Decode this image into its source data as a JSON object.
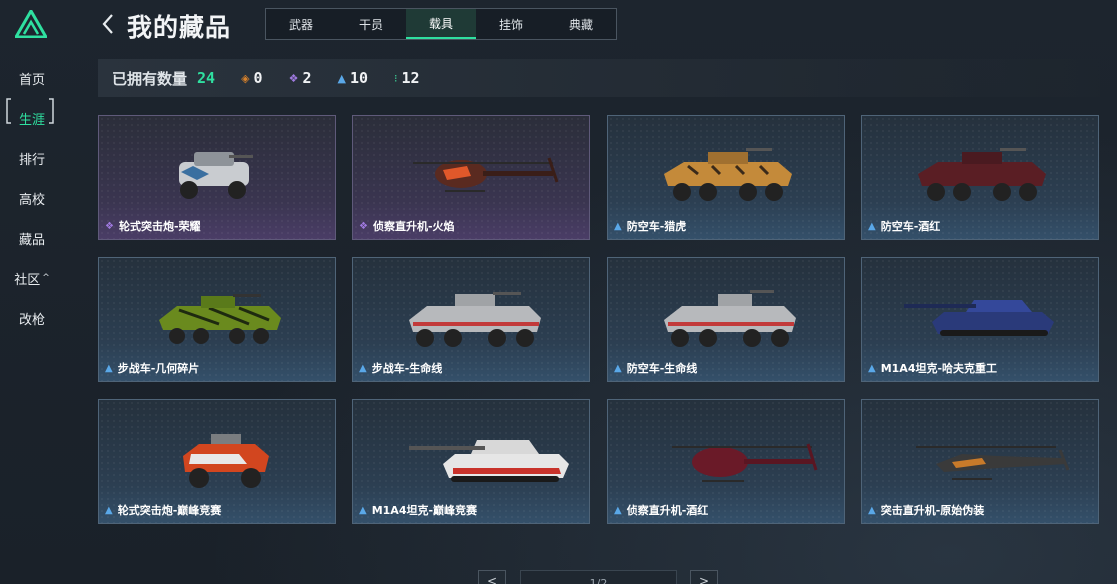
{
  "nav": {
    "items": [
      {
        "label": "首页"
      },
      {
        "label": "生涯"
      },
      {
        "label": "排行"
      },
      {
        "label": "高校"
      },
      {
        "label": "藏品"
      },
      {
        "label": "社区",
        "chevron": "^"
      },
      {
        "label": "改枪"
      }
    ]
  },
  "header": {
    "title": "我的藏品",
    "tabs": [
      {
        "label": "武器"
      },
      {
        "label": "干员"
      },
      {
        "label": "载具"
      },
      {
        "label": "挂饰"
      },
      {
        "label": "典藏"
      }
    ]
  },
  "stats": {
    "owned_label": "已拥有数量",
    "owned_count": "24",
    "rarity_counts": [
      {
        "icon": "orange-gem-icon",
        "color": "#d9822b",
        "value": "0"
      },
      {
        "icon": "purple-gem-icon",
        "color": "#a07ae0",
        "value": "2"
      },
      {
        "icon": "blue-gem-icon",
        "color": "#5aa8e8",
        "value": "10"
      },
      {
        "icon": "green-gem-icon",
        "color": "#3ed69a",
        "value": "12"
      }
    ]
  },
  "items": [
    {
      "name": "轮式突击炮-荣耀",
      "rarity": "purple"
    },
    {
      "name": "侦察直升机-火焰",
      "rarity": "purple"
    },
    {
      "name": "防空车-猎虎",
      "rarity": "blue"
    },
    {
      "name": "防空车-酒红",
      "rarity": "blue"
    },
    {
      "name": "步战车-几何碎片",
      "rarity": "blue"
    },
    {
      "name": "步战车-生命线",
      "rarity": "blue"
    },
    {
      "name": "防空车-生命线",
      "rarity": "blue"
    },
    {
      "name": "M1A4坦克-哈夫克重工",
      "rarity": "blue"
    },
    {
      "name": "轮式突击炮-巅峰竞赛",
      "rarity": "blue"
    },
    {
      "name": "M1A4坦克-巅峰竞赛",
      "rarity": "blue"
    },
    {
      "name": "侦察直升机-酒红",
      "rarity": "blue"
    },
    {
      "name": "突击直升机-原始伪装",
      "rarity": "blue"
    }
  ],
  "pager": {
    "prev": "<",
    "next": ">",
    "page": "1/2"
  },
  "colors": {
    "accent": "#2fe0a0",
    "purple": "#a07ae0",
    "blue": "#5aa8e8"
  }
}
